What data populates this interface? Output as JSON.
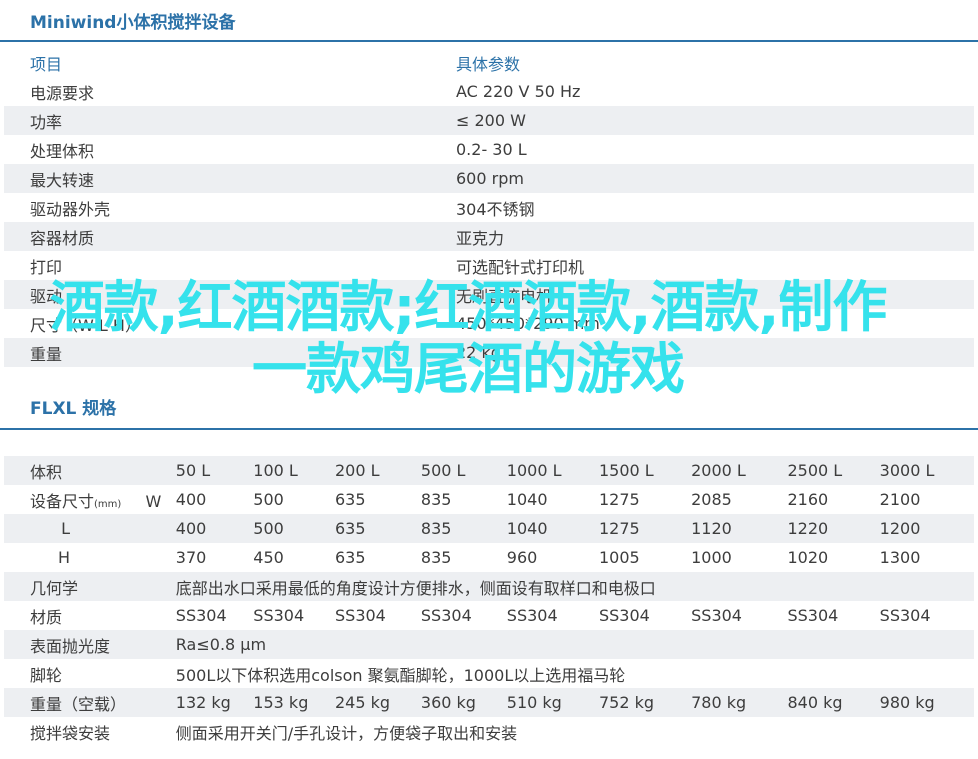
{
  "title": "Miniwind小体积搅拌设备",
  "spec_table": {
    "header": {
      "item": "项目",
      "param": "具体参数"
    },
    "rows": [
      {
        "item": "电源要求",
        "value": "AC 220  V 50 Hz"
      },
      {
        "item": "功率",
        "value": "≤ 200 W"
      },
      {
        "item": "处理体积",
        "value": "0.2-  30 L"
      },
      {
        "item": "最大转速",
        "value": "600  rpm"
      },
      {
        "item": "驱动器外壳",
        "value": "304不锈钢"
      },
      {
        "item": "容器材质",
        "value": "亚克力"
      },
      {
        "item": "打印",
        "value": "可选配针式打印机"
      },
      {
        "item": "驱动",
        "value": "无刷直流电机"
      },
      {
        "item": "尺寸（W L H）",
        "value": "450*450*290 mm"
      },
      {
        "item": "重量",
        "value": "22 kg"
      }
    ]
  },
  "title2": "FLXL 规格",
  "model_table": {
    "rows": [
      {
        "label": "体积",
        "sub": "",
        "dim": "",
        "values": [
          "50 L",
          "100 L",
          "200 L",
          "500 L",
          "1000 L",
          "1500 L",
          "2000 L",
          "2500 L",
          "3000 L"
        ]
      },
      {
        "label": "设备尺寸",
        "sub": "(mm)",
        "dim": "W",
        "values": [
          "400",
          "500",
          "635",
          "835",
          "1040",
          "1275",
          "2085",
          "2160",
          "2100"
        ]
      },
      {
        "label": "",
        "sub": "",
        "dim": "L",
        "values": [
          "400",
          "500",
          "635",
          "835",
          "1040",
          "1275",
          "1120",
          "1220",
          "1200"
        ]
      },
      {
        "label": "",
        "sub": "",
        "dim": "H",
        "values": [
          "370",
          "450",
          "635",
          "835",
          "960",
          "1005",
          "1000",
          "1020",
          "1300"
        ]
      }
    ],
    "span_rows": [
      {
        "label": "几何学",
        "text": "底部出水口采用最低的角度设计方便排水，侧面设有取样口和电极口"
      }
    ],
    "material": {
      "label": "材质",
      "values": [
        "SS304",
        "SS304",
        "SS304",
        "SS304",
        "SS304",
        "SS304",
        "SS304",
        "SS304",
        "SS304"
      ]
    },
    "span_rows2": [
      {
        "label": "表面抛光度",
        "text": "Ra≤0.8 μm"
      },
      {
        "label": "脚轮",
        "text": "500L以下体积选用colson 聚氨酯脚轮，1000L以上选用福马轮"
      }
    ],
    "weight": {
      "label": "重量（空载）",
      "values": [
        "132 kg",
        "153 kg",
        "245 kg",
        "360 kg",
        "510 kg",
        "752 kg",
        "780 kg",
        "840 kg",
        "980 kg"
      ]
    },
    "bag": {
      "label": "搅拌袋安装",
      "text": "侧面采用开关门/手孔设计，方便袋子取出和安装"
    }
  },
  "overlay_text": "酒款,红酒酒款;红酒酒款,酒款,制作一款鸡尾酒的游戏",
  "colors": {
    "accent": "#2c72a8",
    "overlay": "#35e2ec",
    "stripe": "#edeff2"
  }
}
